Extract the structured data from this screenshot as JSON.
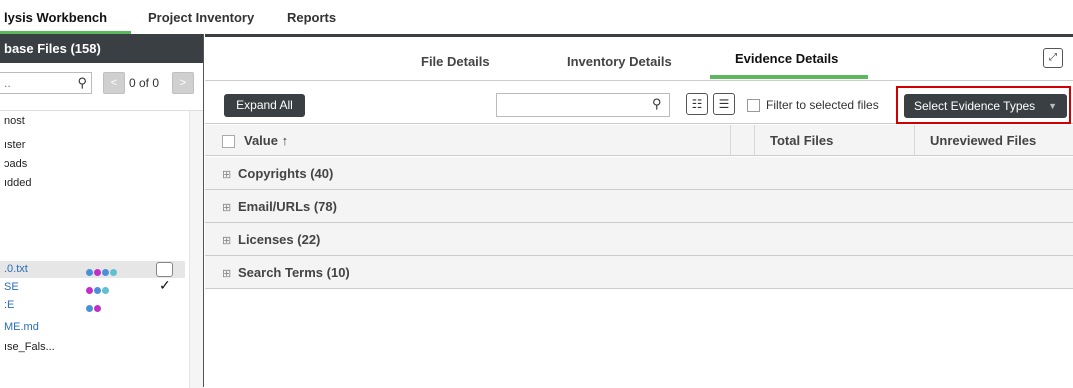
{
  "topnav": {
    "tabs": [
      {
        "label": "lysis Workbench"
      },
      {
        "label": "Project Inventory"
      },
      {
        "label": "Reports"
      }
    ]
  },
  "left_panel": {
    "header": "base Files (158)",
    "search_value": "..",
    "pager_prev": "<",
    "pager_next": ">",
    "pager_text": "0 of 0",
    "tree_items": [
      {
        "label": "nost"
      },
      {
        "label": "ıster"
      },
      {
        "label": "ɔads"
      },
      {
        "label": "ıdded"
      },
      {
        "label": ".0.txt"
      },
      {
        "label": "SE"
      },
      {
        "label": ":E"
      },
      {
        "label": "ME.md"
      },
      {
        "label": "ıse_Fals..."
      }
    ],
    "check_mark": "✓"
  },
  "detail_tabs": {
    "tabs": [
      {
        "label": "File Details"
      },
      {
        "label": "Inventory Details"
      },
      {
        "label": "Evidence Details"
      }
    ],
    "active": "Evidence Details"
  },
  "toolbar": {
    "expand_all": "Expand All",
    "search_value": "",
    "filter_label": "Filter to selected files",
    "select_evidence": "Select Evidence Types"
  },
  "table": {
    "columns": [
      {
        "label": "Value ↑"
      },
      {
        "label": "Total Files"
      },
      {
        "label": "Unreviewed Files"
      }
    ],
    "groups": [
      {
        "label": "Copyrights (40)"
      },
      {
        "label": "Email/URLs (78)"
      },
      {
        "label": "Licenses (22)"
      },
      {
        "label": "Search Terms (10)"
      }
    ]
  },
  "colors": {
    "accent_green": "#5cb85c",
    "dark_button": "#3a3f44",
    "highlight_red": "#d00000",
    "dot_blue": "#4a90d9",
    "dot_purple": "#c02fc8",
    "dot_teal": "#5fc0cf"
  },
  "icons": {
    "search": "search-icon",
    "expand_view": "expand-view-icon",
    "tree_view": "tree-view-icon",
    "list_view": "list-view-icon"
  }
}
